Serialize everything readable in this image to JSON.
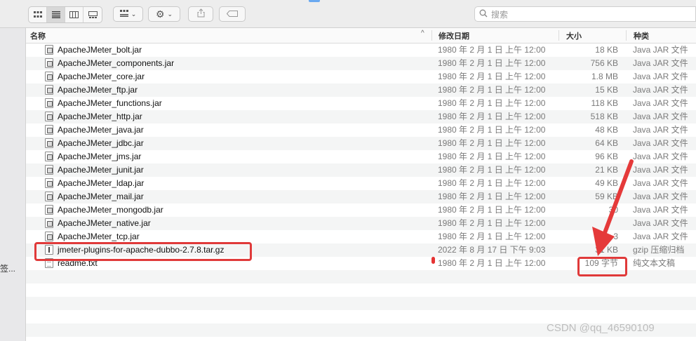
{
  "toolbar": {
    "search_placeholder": "搜索",
    "view_icons": [
      "icon-view-icon",
      "list-view-icon",
      "column-view-icon",
      "gallery-view-icon"
    ],
    "group_icon": "group-by-icon",
    "action_icon": "gear-icon",
    "share_icon": "share-icon",
    "tag_icon": "tag-icon"
  },
  "header": {
    "name": "名称",
    "date": "修改日期",
    "size": "大小",
    "kind": "种类"
  },
  "sidebar": {
    "fragment": "签..."
  },
  "files": [
    {
      "icon": "jar",
      "name": "ApacheJMeter_bolt.jar",
      "date": "1980 年 2 月 1 日 上午 12:00",
      "size": "18 KB",
      "kind": "Java JAR 文件"
    },
    {
      "icon": "jar",
      "name": "ApacheJMeter_components.jar",
      "date": "1980 年 2 月 1 日 上午 12:00",
      "size": "756 KB",
      "kind": "Java JAR 文件"
    },
    {
      "icon": "jar",
      "name": "ApacheJMeter_core.jar",
      "date": "1980 年 2 月 1 日 上午 12:00",
      "size": "1.8 MB",
      "kind": "Java JAR 文件"
    },
    {
      "icon": "jar",
      "name": "ApacheJMeter_ftp.jar",
      "date": "1980 年 2 月 1 日 上午 12:00",
      "size": "15 KB",
      "kind": "Java JAR 文件"
    },
    {
      "icon": "jar",
      "name": "ApacheJMeter_functions.jar",
      "date": "1980 年 2 月 1 日 上午 12:00",
      "size": "118 KB",
      "kind": "Java JAR 文件"
    },
    {
      "icon": "jar",
      "name": "ApacheJMeter_http.jar",
      "date": "1980 年 2 月 1 日 上午 12:00",
      "size": "518 KB",
      "kind": "Java JAR 文件"
    },
    {
      "icon": "jar",
      "name": "ApacheJMeter_java.jar",
      "date": "1980 年 2 月 1 日 上午 12:00",
      "size": "48 KB",
      "kind": "Java JAR 文件"
    },
    {
      "icon": "jar",
      "name": "ApacheJMeter_jdbc.jar",
      "date": "1980 年 2 月 1 日 上午 12:00",
      "size": "64 KB",
      "kind": "Java JAR 文件"
    },
    {
      "icon": "jar",
      "name": "ApacheJMeter_jms.jar",
      "date": "1980 年 2 月 1 日 上午 12:00",
      "size": "96 KB",
      "kind": "Java JAR 文件"
    },
    {
      "icon": "jar",
      "name": "ApacheJMeter_junit.jar",
      "date": "1980 年 2 月 1 日 上午 12:00",
      "size": "21 KB",
      "kind": "Java JAR 文件"
    },
    {
      "icon": "jar",
      "name": "ApacheJMeter_ldap.jar",
      "date": "1980 年 2 月 1 日 上午 12:00",
      "size": "49 KB",
      "kind": "Java JAR 文件"
    },
    {
      "icon": "jar",
      "name": "ApacheJMeter_mail.jar",
      "date": "1980 年 2 月 1 日 上午 12:00",
      "size": "59 KB",
      "kind": "Java JAR 文件"
    },
    {
      "icon": "jar",
      "name": "ApacheJMeter_mongodb.jar",
      "date": "1980 年 2 月 1 日 上午 12:00",
      "size": "30",
      "kind": "Java JAR 文件"
    },
    {
      "icon": "jar",
      "name": "ApacheJMeter_native.jar",
      "date": "1980 年 2 月 1 日 上午 12:00",
      "size": "",
      "kind": "Java JAR 文件"
    },
    {
      "icon": "jar",
      "name": "ApacheJMeter_tcp.jar",
      "date": "1980 年 2 月 1 日 上午 12:00",
      "size": "3",
      "kind": "Java JAR 文件"
    },
    {
      "icon": "gz",
      "name": "jmeter-plugins-for-apache-dubbo-2.7.8.tar.gz",
      "date": "2022 年 8 月 17 日 下午 9:03",
      "size": "31 KB",
      "kind": "gzip 压缩归档"
    },
    {
      "icon": "txt",
      "name": "readme.txt",
      "date": "1980 年 2 月 1 日 上午 12:00",
      "size": "109 字节",
      "kind": "纯文本文稿"
    }
  ],
  "annotations": {
    "color": "#e03a3a"
  },
  "watermark": "CSDN @qq_46590109"
}
